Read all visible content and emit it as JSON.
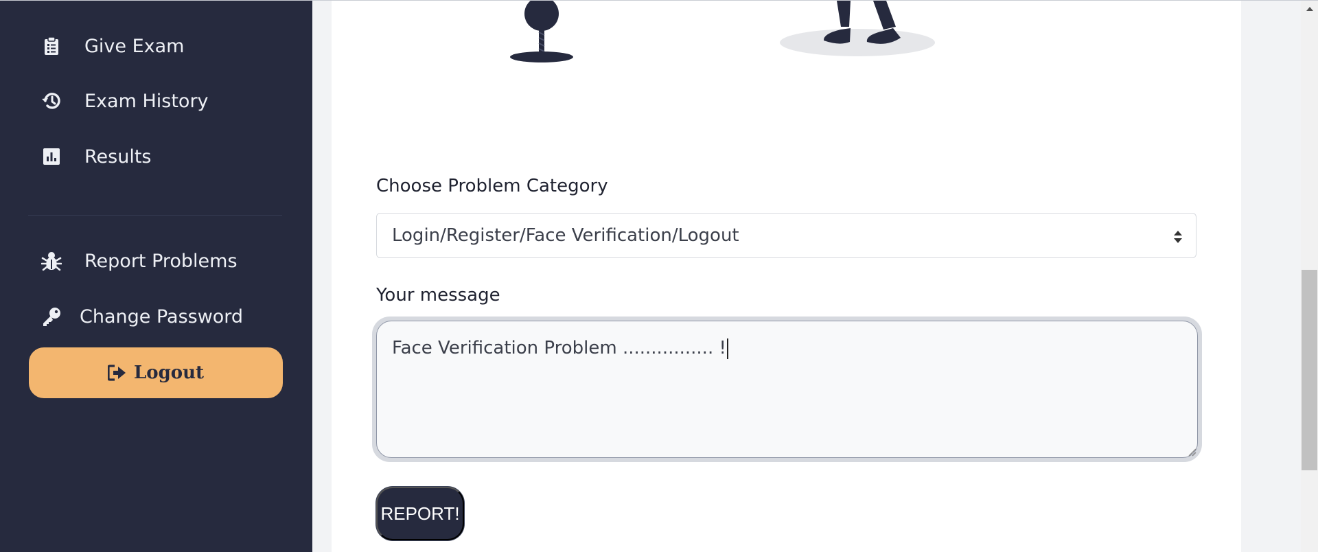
{
  "sidebar": {
    "items": [
      {
        "label": "Give Exam",
        "icon": "clipboard-icon"
      },
      {
        "label": "Exam History",
        "icon": "history-icon"
      },
      {
        "label": "Results",
        "icon": "bar-chart-icon"
      },
      {
        "label": "Report Problems",
        "icon": "bug-icon"
      },
      {
        "label": "Change Password",
        "icon": "key-icon"
      }
    ],
    "logout_label": "Logout"
  },
  "form": {
    "category_label": "Choose Problem Category",
    "category_value": "Login/Register/Face Verification/Logout",
    "message_label": "Your message",
    "message_value": "Face Verification Problem ................ !",
    "submit_label": "REPORT!"
  },
  "colors": {
    "sidebar_bg": "#262a3e",
    "accent": "#f3b66f",
    "button_dark": "#262a3e"
  }
}
